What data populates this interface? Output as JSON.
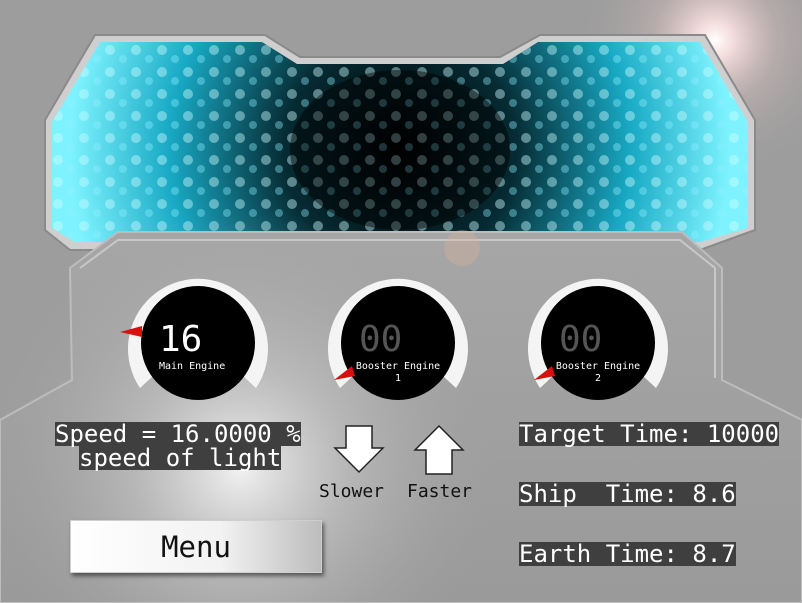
{
  "gauges": [
    {
      "value": "16",
      "label": "Main Engine",
      "label_line2": "",
      "level": 0.16,
      "active": true
    },
    {
      "value": "00",
      "label": "Booster Engine",
      "label_line2": "1",
      "level": 0.0,
      "active": false
    },
    {
      "value": "00",
      "label": "Booster Engine",
      "label_line2": "2",
      "level": 0.0,
      "active": false
    }
  ],
  "speed": {
    "line1": "Speed = 16.0000 %",
    "line2": "speed of light"
  },
  "controls": {
    "slower_label": "Slower",
    "faster_label": "Faster"
  },
  "times": {
    "target": "Target Time: 10000",
    "ship": "Ship  Time: 8.6",
    "earth": "Earth Time: 8.7"
  },
  "menu": {
    "label": "Menu"
  },
  "colors": {
    "panel_gray": "#9d9d9d",
    "screen_glow": "#38d8f0",
    "needle_red": "#d81010",
    "text_active": "#ffffff",
    "text_inactive": "#555555"
  },
  "icons": {
    "slower": "arrow-down-icon",
    "faster": "arrow-up-icon"
  }
}
